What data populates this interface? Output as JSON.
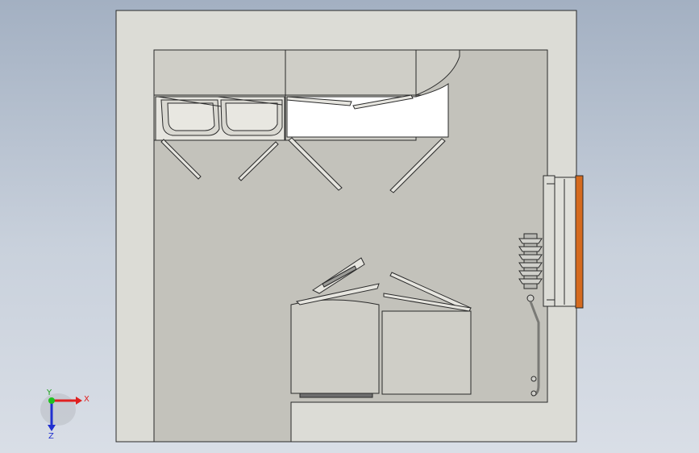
{
  "view": {
    "type": "cad-top-view",
    "background_top": "#a3b0c2",
    "background_bottom": "#d9dee6"
  },
  "colors": {
    "wall": "#dcdcd6",
    "floor": "#c3c2bb",
    "furniture": "#cfcec7",
    "outline": "#2a2a2a",
    "window_frame": "#e0a060",
    "window_sill": "#d56a1e",
    "white_surface": "#ffffff"
  },
  "triad": {
    "x_label": "X",
    "y_label": "Y",
    "z_label": "Z",
    "x_color": "#e02020",
    "y_color": "#20c020",
    "z_color": "#2030d0"
  }
}
